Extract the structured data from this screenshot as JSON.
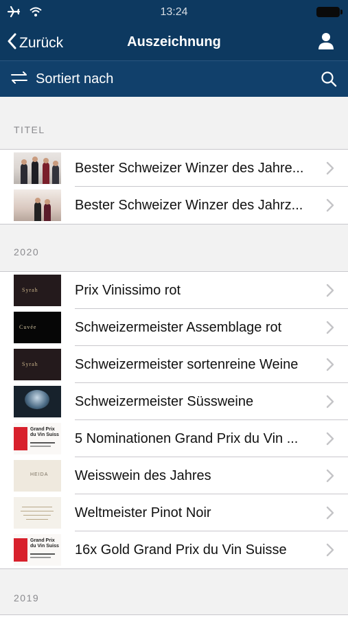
{
  "status_bar": {
    "time": "13:24"
  },
  "nav": {
    "back_label": "Zurück",
    "title": "Auszeichnung"
  },
  "sort_bar": {
    "label": "Sortiert nach"
  },
  "sections": [
    {
      "header": "TITEL",
      "items": [
        {
          "title": "Bester Schweizer Winzer des Jahre...",
          "thumb": "photo-group"
        },
        {
          "title": "Bester Schweizer Winzer des Jahrz...",
          "thumb": "photo-group-2"
        }
      ]
    },
    {
      "header": "2020",
      "items": [
        {
          "title": "Prix Vinissimo rot",
          "thumb": "wine-label-syrah"
        },
        {
          "title": "Schweizermeister Assemblage rot",
          "thumb": "wine-label-cuvee"
        },
        {
          "title": "Schweizermeister sortenreine Weine",
          "thumb": "wine-label-syrah"
        },
        {
          "title": "Schweizermeister Süssweine",
          "thumb": "ice-bottle"
        },
        {
          "title": "5 Nominationen Grand Prix du Vin ...",
          "thumb": "grand-prix-logo"
        },
        {
          "title": "Weisswein des Jahres",
          "thumb": "wine-label-cream"
        },
        {
          "title": "Weltmeister Pinot Noir",
          "thumb": "certificate"
        },
        {
          "title": "16x Gold Grand Prix du Vin Suisse",
          "thumb": "grand-prix-logo"
        }
      ]
    },
    {
      "header": "2019",
      "items": []
    }
  ],
  "thumb_text": {
    "gp": "Grand Prix du Vin Suiss",
    "syrah": "Syrah",
    "cuvee": "Cuvée",
    "heida": "HEIDA"
  },
  "colors": {
    "nav_bg": "#0d3960",
    "sort_bg": "#11406b",
    "list_bg": "#f2f2f2"
  }
}
